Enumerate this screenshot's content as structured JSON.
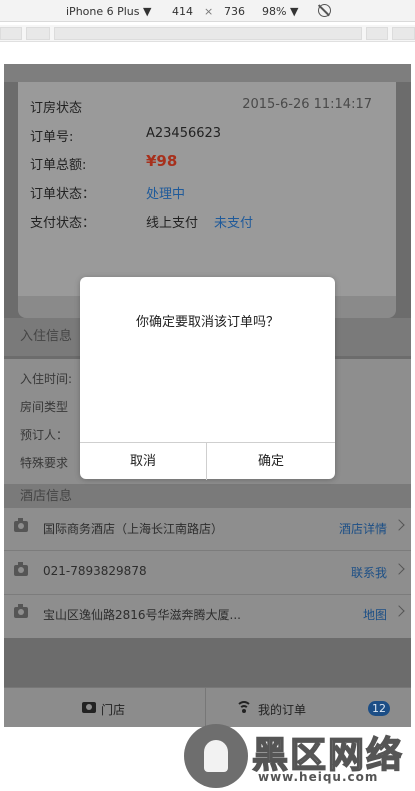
{
  "devtools": {
    "device": "iPhone 6 Plus ▼",
    "width": "414",
    "times": "×",
    "height": "736",
    "zoom": "98% ▼"
  },
  "order": {
    "section_title": "订房状态",
    "datetime": "2015-6-26  11:14:17",
    "order_no_label": "订单号:",
    "order_no": "A23456623",
    "total_label": "订单总额:",
    "total": "¥98",
    "status_label": "订单状态：",
    "status": "处理中",
    "pay_label": "支付状态：",
    "pay_method": "线上支付",
    "pay_status": "未支付"
  },
  "guest": {
    "section_title": "入住信息",
    "checkin_label": "入住时间:",
    "room_type_label": "房间类型",
    "booker_label": "预订人：",
    "special_label": "特殊要求"
  },
  "hotel": {
    "section_title": "酒店信息",
    "name": "国际商务酒店（上海长江南路店）",
    "name_link": "酒店详情",
    "phone": "021-7893829878",
    "phone_link": "联系我",
    "address": "宝山区逸仙路2816号华滋奔腾大厦...",
    "address_link": "地图"
  },
  "tabs": {
    "store": "门店",
    "my_orders": "我的订单",
    "badge": "12"
  },
  "dialog": {
    "message": "你确定要取消该订单吗？",
    "cancel": "取消",
    "confirm": "确定"
  },
  "watermark": {
    "text": "黑区网络",
    "url": "www.heiqu.com"
  }
}
